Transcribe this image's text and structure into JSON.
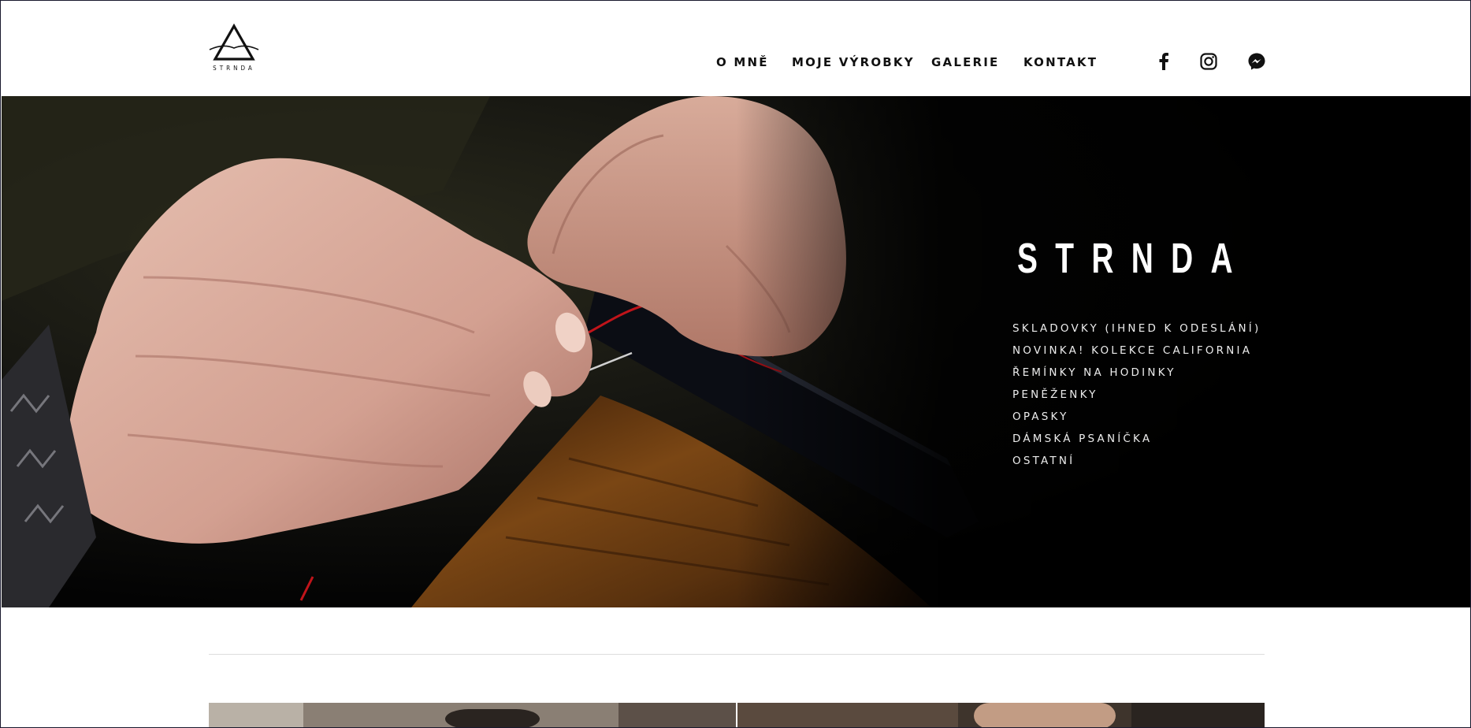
{
  "brand": {
    "logo_text": "STRNDA"
  },
  "nav": {
    "items": [
      "O MNĚ",
      "MOJE VÝROBKY",
      "GALERIE",
      "KONTAKT"
    ]
  },
  "social": {
    "icons": [
      "facebook-icon",
      "instagram-icon",
      "messenger-icon"
    ]
  },
  "hero": {
    "title": "STRNDA",
    "menu": [
      "SKLADOVKY (IHNED K ODESLÁNÍ)",
      "NOVINKA! KOLEKCE CALIFORNIA",
      "ŘEMÍNKY NA HODINKY",
      "PENĚŽENKY",
      "OPASKY",
      "DÁMSKÁ PSANÍČKA",
      "OSTATNÍ"
    ]
  },
  "colors": {
    "text_dark": "#111111",
    "hero_bg": "#050403",
    "hero_text": "#ffffff",
    "thread_red": "#c0141a",
    "divider": "#dddddd"
  }
}
